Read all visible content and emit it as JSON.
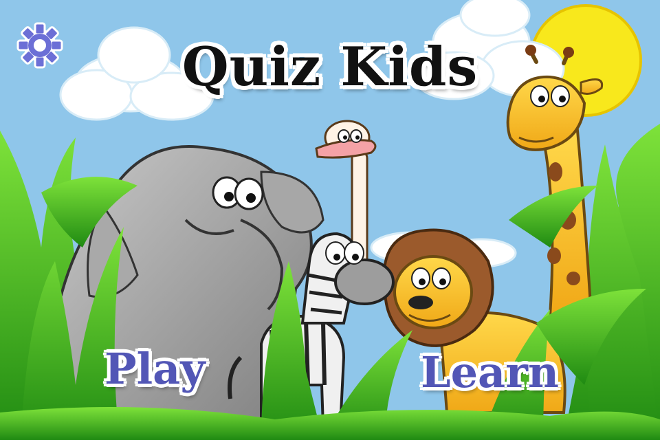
{
  "app": {
    "title": "Quiz Kids"
  },
  "menu": {
    "play_label": "Play",
    "learn_label": "Learn"
  },
  "icons": {
    "settings": "gear-icon"
  },
  "colors": {
    "sky": "#8fc6ea",
    "button_text": "#5256b6",
    "title_text": "#111111",
    "sun": "#f8e81c",
    "grass": "#3fae1a"
  }
}
